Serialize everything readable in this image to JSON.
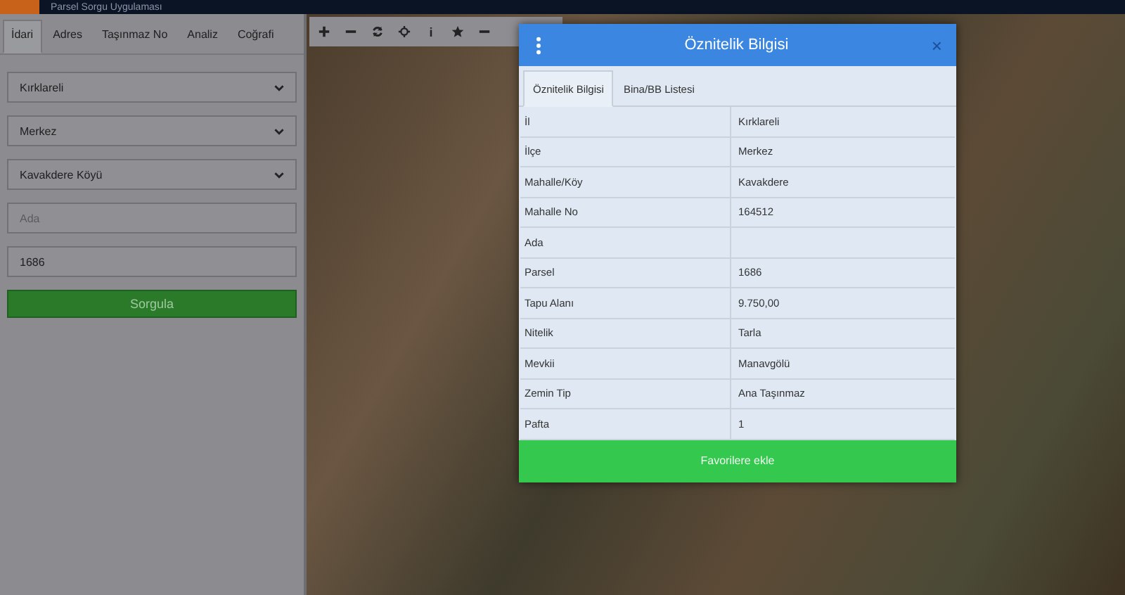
{
  "app_header": {
    "title": "Parsel Sorgu Uygulaması"
  },
  "sidebar": {
    "tabs": [
      {
        "label": "İdari",
        "selected": true
      },
      {
        "label": "Adres",
        "selected": false
      },
      {
        "label": "Taşınmaz No",
        "selected": false
      },
      {
        "label": "Analiz",
        "selected": false
      },
      {
        "label": "Coğrafi",
        "selected": false
      }
    ],
    "fields": [
      {
        "kind": "select",
        "value": "Kırklareli"
      },
      {
        "kind": "select",
        "value": "Merkez"
      },
      {
        "kind": "select",
        "value": "Kavakdere Köyü"
      },
      {
        "kind": "input",
        "placeholder": "Ada"
      },
      {
        "kind": "input",
        "value": "1686"
      }
    ],
    "button": "Sorgula"
  },
  "map_toolbar": [
    {
      "kind": "plus"
    },
    {
      "kind": "minus"
    },
    {
      "kind": "refresh"
    },
    {
      "kind": "crosshair"
    },
    {
      "kind": "info",
      "label": "i"
    },
    {
      "kind": "star"
    },
    {
      "kind": "line"
    }
  ],
  "dialog": {
    "title": "Öznitelik Bilgisi",
    "close": "×",
    "tabs": [
      {
        "label": "Öznitelik Bilgisi",
        "selected": true
      },
      {
        "label": "Bina/BB Listesi",
        "selected": false
      }
    ],
    "rows": [
      {
        "label": "İl",
        "value": "Kırklareli"
      },
      {
        "label": "İlçe",
        "value": "Merkez"
      },
      {
        "label": "Mahalle/Köy",
        "value": "Kavakdere"
      },
      {
        "label": "Mahalle No",
        "value": "164512"
      },
      {
        "label": "Ada"
      },
      {
        "label": "Parsel",
        "value": "1686"
      },
      {
        "label": "Tapu Alanı",
        "value": "9.750,00"
      },
      {
        "label": "Nitelik",
        "value": "Tarla"
      },
      {
        "label": "Mevkii",
        "value": "Manavgölü"
      },
      {
        "label": "Zemin Tip",
        "value": "Ana Taşınmaz"
      },
      {
        "label": "Pafta",
        "value": "1"
      }
    ],
    "button": "Favorilere ekle"
  }
}
